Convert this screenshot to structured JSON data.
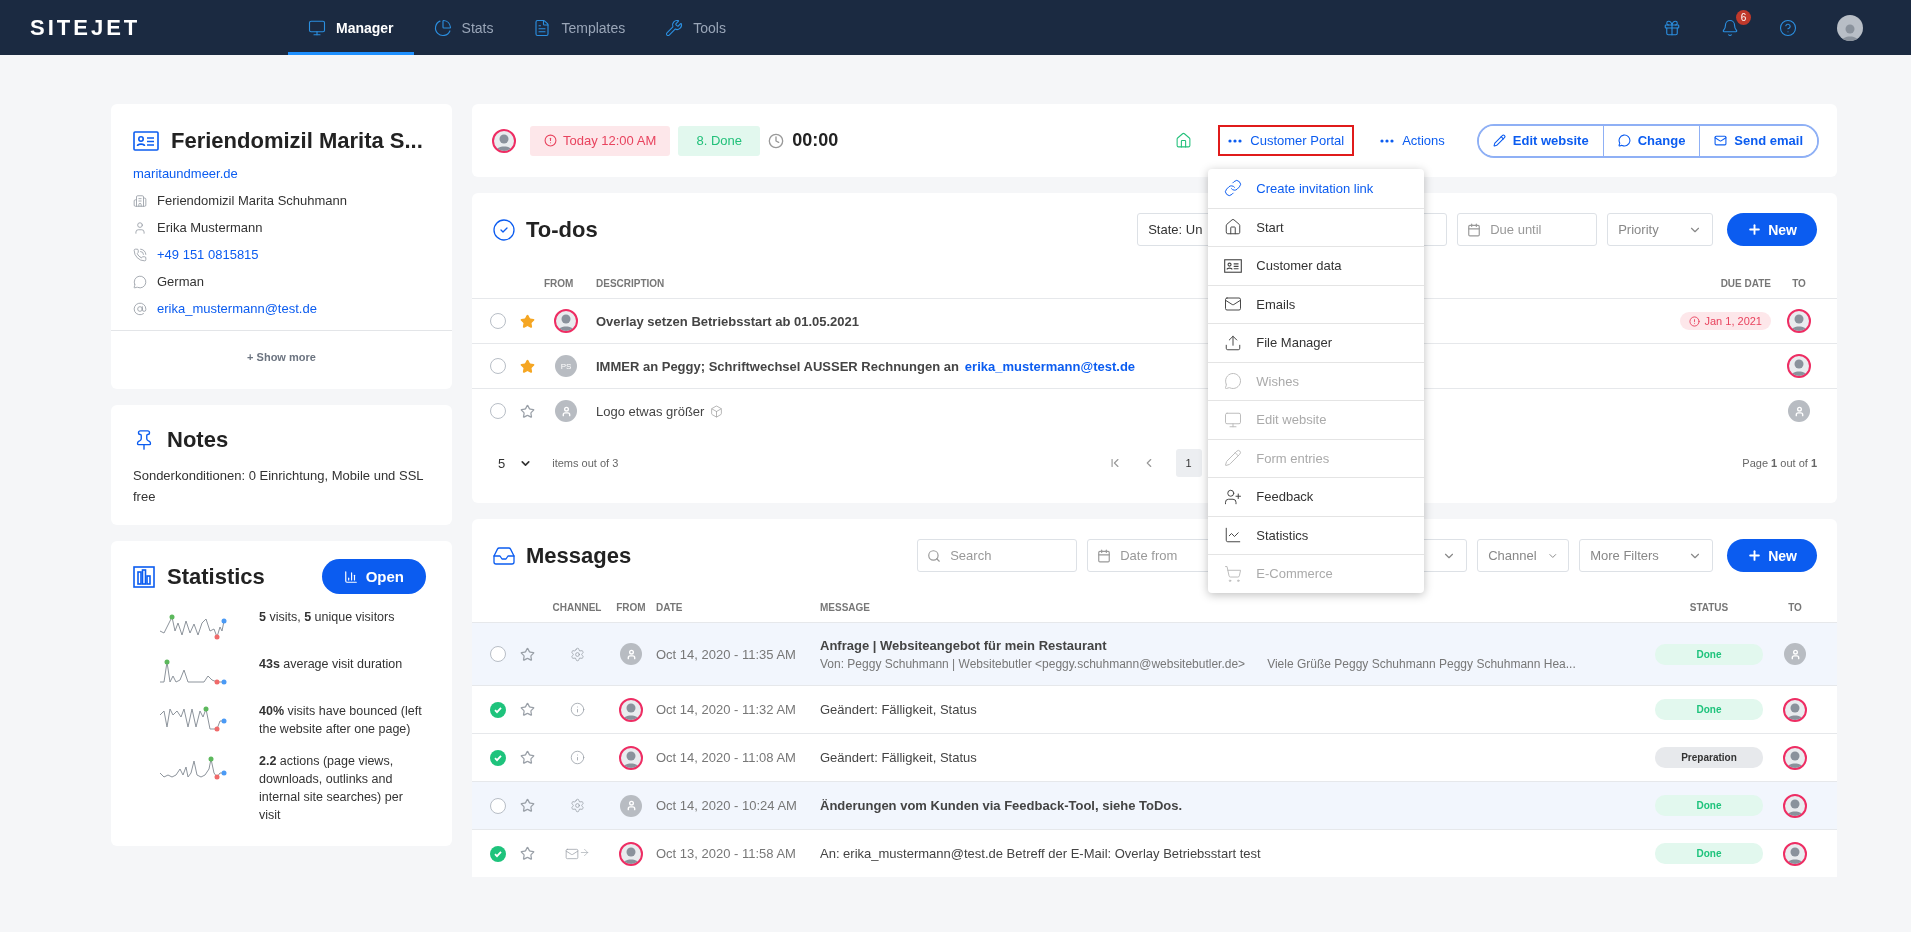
{
  "nav": {
    "brand": "SITEJET",
    "tabs": [
      {
        "label": "Manager",
        "selected": true
      },
      {
        "label": "Stats",
        "selected": false
      },
      {
        "label": "Templates",
        "selected": false
      },
      {
        "label": "Tools",
        "selected": false
      }
    ],
    "notification_count": "6"
  },
  "contact": {
    "title": "Feriendomizil Marita S...",
    "website": "maritaundmeer.de",
    "rows": [
      {
        "kind": "company",
        "text": "Feriendomizil Marita Schuhmann"
      },
      {
        "kind": "person",
        "text": "Erika Mustermann"
      },
      {
        "kind": "phone",
        "text": "+49 151 0815815"
      },
      {
        "kind": "language",
        "text": "German"
      },
      {
        "kind": "email",
        "text": "erika_mustermann@test.de"
      }
    ],
    "show_more": "+ Show more"
  },
  "notes": {
    "title": "Notes",
    "text": "Sonderkonditionen: 0 Einrichtung, Mobile und SSL free"
  },
  "statistics": {
    "title": "Statistics",
    "open_button": "Open",
    "items": [
      "**5** visits, **5** unique visitors",
      "**43s** average visit duration",
      "**40%** visits have bounced (left the website after one page)",
      "**2.2** actions (page views, downloads, outlinks and internal site searches) per visit"
    ]
  },
  "project_bar": {
    "due": "Today 12:00 AM",
    "stage": "8. Done",
    "timer": "00:00",
    "customer_portal": {
      "label": "Customer Portal",
      "highlighted": true
    },
    "actions": "Actions",
    "buttons": [
      "Edit website",
      "Change",
      "Send email"
    ]
  },
  "portal_menu": [
    {
      "label": "Create invitation link",
      "highlighted": true,
      "disabled": false
    },
    {
      "label": "Start",
      "highlighted": false,
      "disabled": false
    },
    {
      "label": "Customer data",
      "highlighted": false,
      "disabled": false
    },
    {
      "label": "Emails",
      "highlighted": false,
      "disabled": false
    },
    {
      "label": "File Manager",
      "highlighted": false,
      "disabled": false
    },
    {
      "label": "Wishes",
      "highlighted": false,
      "disabled": true
    },
    {
      "label": "Edit website",
      "highlighted": false,
      "disabled": true
    },
    {
      "label": "Form entries",
      "highlighted": false,
      "disabled": true
    },
    {
      "label": "Feedback",
      "highlighted": false,
      "disabled": false
    },
    {
      "label": "Statistics",
      "highlighted": false,
      "disabled": false
    },
    {
      "label": "E-Commerce",
      "highlighted": false,
      "disabled": true
    }
  ],
  "todos": {
    "title": "To-dos",
    "state_filter": "State: Un",
    "due_placeholder": "Due until",
    "priority": "Priority",
    "new_button": "New",
    "columns": [
      "FROM",
      "DESCRIPTION",
      "DUE DATE",
      "TO"
    ],
    "rows": [
      {
        "done": false,
        "starred": true,
        "from": {
          "kind": "photo"
        },
        "description": "Overlay setzen Betriebsstart ab 01.05.2021",
        "unread": true,
        "attachment": false,
        "due": "Jan 1, 2021",
        "to": {
          "kind": "photo"
        }
      },
      {
        "done": false,
        "starred": true,
        "from": {
          "kind": "initials",
          "text": "PS"
        },
        "description": "IMMER an Peggy; Schriftwechsel AUSSER Rechnungen an",
        "link": "erika_mustermann@test.de",
        "unread": true,
        "attachment": false,
        "to": {
          "kind": "photo"
        }
      },
      {
        "done": false,
        "starred": false,
        "from": {
          "kind": "placeholder"
        },
        "description": "Logo etwas größer",
        "unread": false,
        "attachment": true,
        "to": {
          "kind": "placeholder"
        }
      }
    ],
    "pagination": {
      "page_size": "5",
      "items_text": "items out of 3",
      "page": "1",
      "page_info": "Page **1** out of **1**"
    }
  },
  "messages": {
    "title": "Messages",
    "search_placeholder": "Search",
    "date_placeholder": "Date from",
    "channel": "Channel",
    "more_filters": "More Filters",
    "new_button": "New",
    "columns": [
      "CHANNEL",
      "FROM",
      "DATE",
      "MESSAGE",
      "STATUS",
      "TO"
    ],
    "rows": [
      {
        "done": false,
        "starred": false,
        "channel": {
          "kind": "system"
        },
        "from": {
          "kind": "placeholder"
        },
        "date": "Oct 14, 2020 - 11:35 AM",
        "message": "Anfrage | Websiteangebot für mein Restaurant",
        "sender": "Von: Peggy Schuhmann | Websitebutler <peggy.schuhmann@websitebutler.de>",
        "excerpt": "Viele Grüße Peggy Schuhmann Peggy Schuhmann Hea...",
        "unread": true,
        "status": {
          "label": "Done",
          "kind": "done"
        },
        "to": {
          "kind": "placeholder"
        }
      },
      {
        "done": true,
        "starred": false,
        "channel": {
          "kind": "info"
        },
        "from": {
          "kind": "photo"
        },
        "date": "Oct 14, 2020 - 11:32 AM",
        "message": "Geändert: Fälligkeit, Status",
        "unread": false,
        "status": {
          "label": "Done",
          "kind": "done"
        },
        "to": {
          "kind": "photo"
        }
      },
      {
        "done": true,
        "starred": false,
        "channel": {
          "kind": "info"
        },
        "from": {
          "kind": "photo"
        },
        "date": "Oct 14, 2020 - 11:08 AM",
        "message": "Geändert: Fälligkeit, Status",
        "unread": false,
        "status": {
          "label": "Preparation",
          "kind": "preparation"
        },
        "to": {
          "kind": "photo"
        }
      },
      {
        "done": false,
        "starred": false,
        "channel": {
          "kind": "system"
        },
        "from": {
          "kind": "placeholder"
        },
        "date": "Oct 14, 2020 - 10:24 AM",
        "message": "Änderungen vom Kunden via Feedback-Tool, siehe ToDos.",
        "unread": true,
        "status": {
          "label": "Done",
          "kind": "done"
        },
        "to": {
          "kind": "photo"
        }
      },
      {
        "done": true,
        "starred": false,
        "channel": {
          "kind": "email"
        },
        "from": {
          "kind": "photo"
        },
        "date": "Oct 13, 2020 - 11:58 AM",
        "message": "An: erika_mustermann@test.de Betreff der E-Mail: Overlay Betriebsstart test",
        "unread": false,
        "status": {
          "label": "Done",
          "kind": "done"
        },
        "to": {
          "kind": "photo"
        }
      }
    ]
  }
}
